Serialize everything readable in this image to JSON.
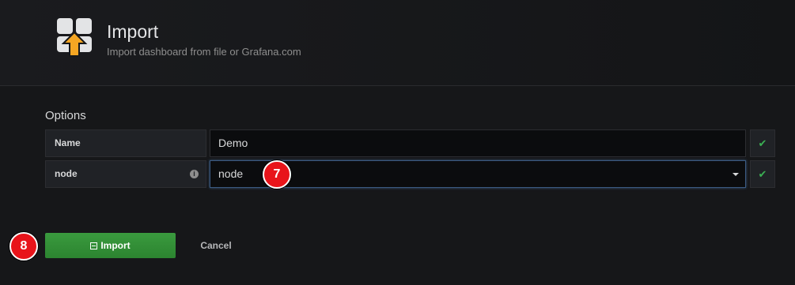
{
  "header": {
    "title": "Import",
    "subtitle": "Import dashboard from file or Grafana.com"
  },
  "options": {
    "heading": "Options",
    "fields": [
      {
        "label": "Name",
        "value": "Demo",
        "status": "valid"
      },
      {
        "label": "node",
        "value": "node",
        "status": "valid",
        "has_info": true
      }
    ]
  },
  "annotations": {
    "step_7": "7",
    "step_8": "8"
  },
  "actions": {
    "import_label": "Import",
    "cancel_label": "Cancel"
  },
  "icons": {
    "logo": "dashboard-import-icon",
    "check": "check-icon",
    "info": "info-icon",
    "caret": "caret-down-icon",
    "save": "save-icon"
  },
  "colors": {
    "primary_button": "#2c8430",
    "valid": "#3bb153",
    "badge": "#e8141a",
    "focus_border": "#3b5a82"
  }
}
